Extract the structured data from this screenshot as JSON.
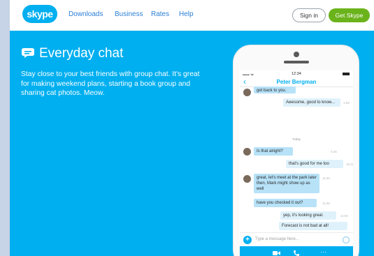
{
  "header": {
    "logo": "skype",
    "nav": [
      "Downloads",
      "Business",
      "Rates",
      "Help"
    ],
    "sign_in": "Sign in",
    "get_skype": "Get Skype"
  },
  "hero": {
    "title": "Everyday chat",
    "description": "Stay close to your best friends with group chat. It's great for making weekend plans, starting a book group and sharing cat photos. Meow.",
    "icon": "chat-bubble-icon"
  },
  "phone": {
    "status": {
      "signal": "••••• ᯤ",
      "time": "12:34"
    },
    "contact": "Peter Bergman",
    "day_separator": "Today",
    "messages": [
      {
        "text": "get back to you.",
        "time": ""
      },
      {
        "text": "Awesome, good to know...",
        "time": "1:59"
      },
      {
        "text": "Is that alright?",
        "time": "3:46"
      },
      {
        "text": "that's good for me too",
        "time": "10:32"
      },
      {
        "text": "great, let's meet at the park later then, Mark might show up as well",
        "time": "11:40"
      },
      {
        "text": "have you checked it out?",
        "time": "11:46"
      },
      {
        "text": "yep, it's looking great.",
        "time": "11:50"
      },
      {
        "text": "Forecast is not bad at all!",
        "time": ""
      }
    ],
    "input_placeholder": "Type a message here...",
    "call_icons": [
      "video-icon",
      "phone-icon",
      "more-icon"
    ]
  },
  "colors": {
    "accent": "#00aff0",
    "green": "#6ab31b",
    "frame": "#c7d3e6"
  }
}
